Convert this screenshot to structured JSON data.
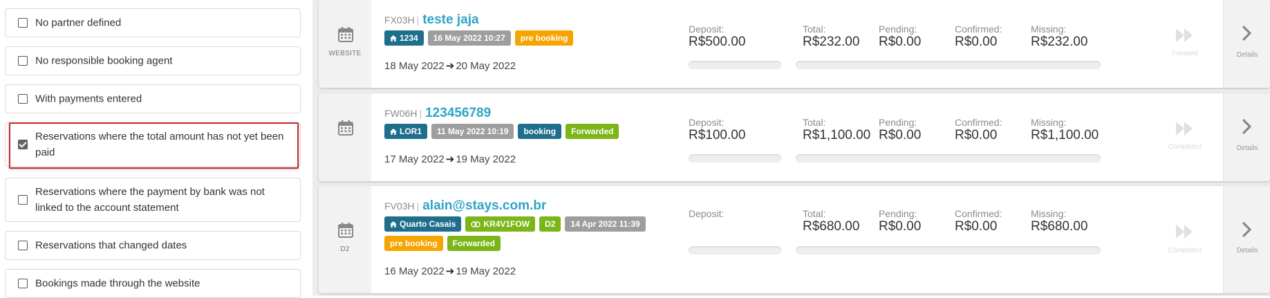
{
  "filters": [
    {
      "label": "No partner defined",
      "checked": false
    },
    {
      "label": "No responsible booking agent",
      "checked": false
    },
    {
      "label": "With payments entered",
      "checked": false
    },
    {
      "label": "Reservations where the total amount has not yet been paid",
      "checked": true
    },
    {
      "label": "Reservations where the payment by bank was not linked to the account statement",
      "checked": false
    },
    {
      "label": "Reservations that changed dates",
      "checked": false
    },
    {
      "label": "Bookings made through the website",
      "checked": false
    }
  ],
  "labels": {
    "deposit": "Deposit:",
    "total": "Total:",
    "pending": "Pending:",
    "confirmed": "Confirmed:",
    "missing": "Missing:",
    "details": "Details",
    "separator": "|"
  },
  "reservations": [
    {
      "source": "WEBSITE",
      "code": "FX03H",
      "guest": "teste jaja",
      "tags": [
        {
          "text": "1234",
          "color": "dark",
          "icon": "home-icon"
        },
        {
          "text": "16 May 2022 10:27",
          "color": "gray"
        },
        {
          "text": "pre booking",
          "color": "orange"
        }
      ],
      "checkin": "18 May 2022",
      "checkout": "20 May 2022",
      "deposit": "R$500.00",
      "total": "R$232.00",
      "pending": "R$0.00",
      "confirmed": "R$0.00",
      "missing": "R$232.00",
      "action": "Forward"
    },
    {
      "source": "",
      "code": "FW06H",
      "guest": "123456789",
      "tags": [
        {
          "text": "LOR1",
          "color": "dark",
          "icon": "home-icon"
        },
        {
          "text": "11 May 2022 10:19",
          "color": "gray"
        },
        {
          "text": "booking",
          "color": "dark"
        },
        {
          "text": "Forwarded",
          "color": "green"
        }
      ],
      "checkin": "17 May 2022",
      "checkout": "19 May 2022",
      "deposit": "R$100.00",
      "total": "R$1,100.00",
      "pending": "R$0.00",
      "confirmed": "R$0.00",
      "missing": "R$1,100.00",
      "action": "Completed"
    },
    {
      "source": "D2",
      "code": "FV03H",
      "guest": "alain@stays.com.br",
      "tags": [
        {
          "text": "Quarto Casais",
          "color": "dark",
          "icon": "home-icon"
        },
        {
          "text": "KR4V1FOW",
          "color": "green",
          "icon": "link-icon"
        },
        {
          "text": "D2",
          "color": "green"
        },
        {
          "text": "14 Apr 2022 11:39",
          "color": "gray"
        },
        {
          "text": "pre booking",
          "color": "orange"
        },
        {
          "text": "Forwarded",
          "color": "green"
        }
      ],
      "checkin": "16 May 2022",
      "checkout": "19 May 2022",
      "deposit": "",
      "total": "R$680.00",
      "pending": "R$0.00",
      "confirmed": "R$0.00",
      "missing": "R$680.00",
      "action": "Completed"
    }
  ]
}
